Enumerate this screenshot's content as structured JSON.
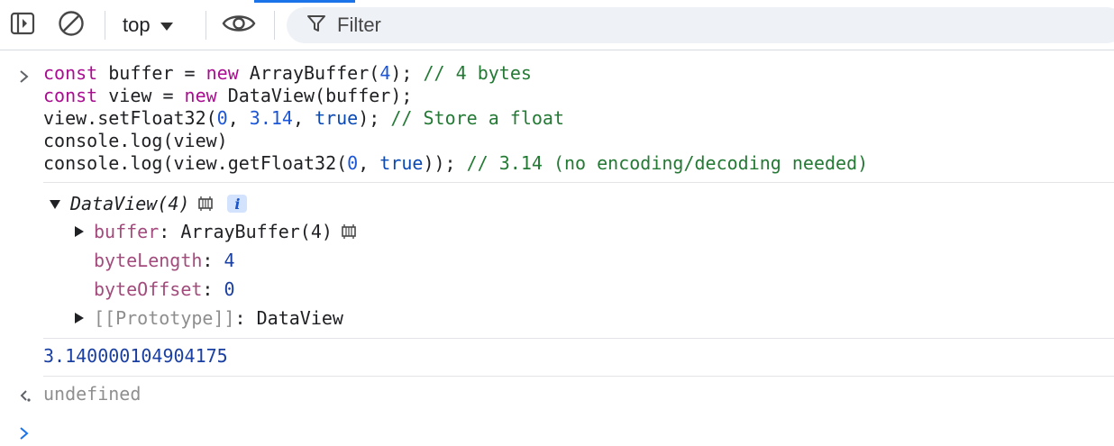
{
  "toolbar": {
    "context_label": "top",
    "filter_placeholder": "Filter",
    "icons": [
      "sidebar-toggle-icon",
      "clear-console-icon",
      "dropdown-caret-icon",
      "live-expression-eye-icon",
      "filter-funnel-icon"
    ]
  },
  "input": {
    "lines": [
      [
        {
          "t": "const",
          "c": "kw"
        },
        {
          "t": " buffer = ",
          "c": ""
        },
        {
          "t": "new",
          "c": "kw"
        },
        {
          "t": " ArrayBuffer(",
          "c": ""
        },
        {
          "t": "4",
          "c": "num"
        },
        {
          "t": "); ",
          "c": ""
        },
        {
          "t": "// 4 bytes",
          "c": "cmt"
        }
      ],
      [
        {
          "t": "const",
          "c": "kw"
        },
        {
          "t": " view = ",
          "c": ""
        },
        {
          "t": "new",
          "c": "kw"
        },
        {
          "t": " DataView(buffer);",
          "c": ""
        }
      ],
      [
        {
          "t": "view.setFloat32(",
          "c": ""
        },
        {
          "t": "0",
          "c": "num"
        },
        {
          "t": ", ",
          "c": ""
        },
        {
          "t": "3.14",
          "c": "num"
        },
        {
          "t": ", ",
          "c": ""
        },
        {
          "t": "true",
          "c": "kw-b"
        },
        {
          "t": "); ",
          "c": ""
        },
        {
          "t": "// Store a float",
          "c": "cmt"
        }
      ],
      [
        {
          "t": "console.log(view)",
          "c": ""
        }
      ],
      [
        {
          "t": "console.log(view.getFloat32(",
          "c": ""
        },
        {
          "t": "0",
          "c": "num"
        },
        {
          "t": ", ",
          "c": ""
        },
        {
          "t": "true",
          "c": "kw-b"
        },
        {
          "t": ")); ",
          "c": ""
        },
        {
          "t": "// 3.14 (no encoding/decoding needed)",
          "c": "cmt"
        }
      ]
    ]
  },
  "output": {
    "object_label": "DataView(4)",
    "info_badge": "i",
    "props": {
      "buffer_name": "buffer",
      "buffer_value": "ArrayBuffer(4)",
      "bytelength_name": "byteLength",
      "bytelength_value": "4",
      "byteoffset_name": "byteOffset",
      "byteoffset_value": "0",
      "prototype_name": "[[Prototype]]",
      "prototype_value": "DataView"
    },
    "float_result": "3.140000104904175",
    "return_value": "undefined"
  },
  "colors": {
    "keyword": "#aa0d91",
    "boolean": "#0b4ab5",
    "number": "#1c56d8",
    "comment": "#247a35",
    "property": "#a24b7c",
    "accent": "#1a73e8"
  }
}
